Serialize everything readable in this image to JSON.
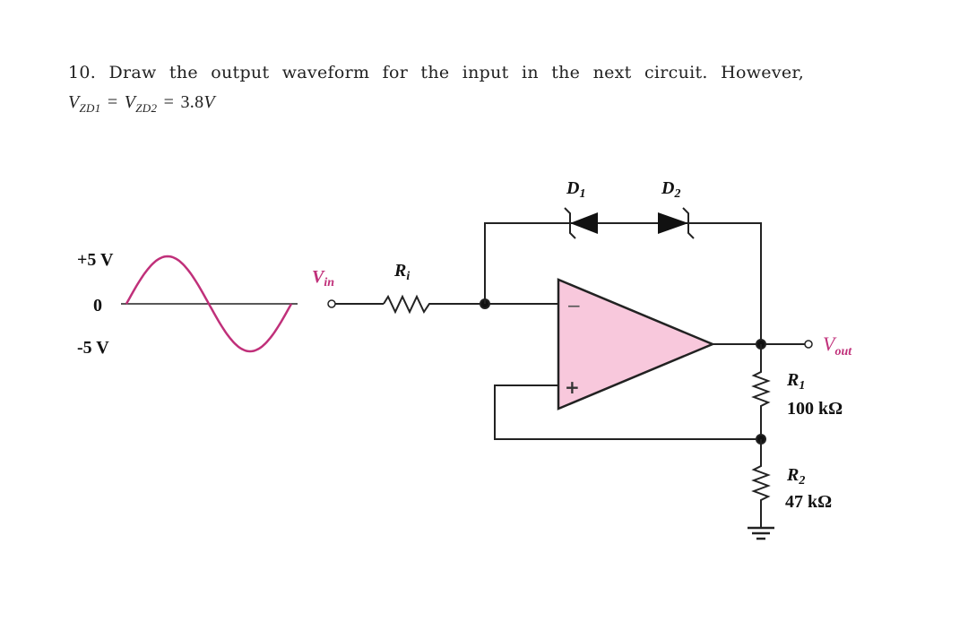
{
  "question": {
    "line1": "10. Draw the output waveform for the input in the next circuit. However,",
    "line2": {
      "v1": "V",
      "s1": "ZD1",
      "eq1": " = ",
      "v2": "V",
      "s2": "ZD2",
      "rest": " = 3.8",
      "unit": "V"
    }
  },
  "input_waveform": {
    "type": "sine",
    "labels": {
      "pos": "+5 V",
      "zero": "0",
      "neg": "-5 V"
    },
    "amplitude_v": 5,
    "color": "#c0307a"
  },
  "circuit": {
    "vin": {
      "main": "V",
      "sub": "in"
    },
    "ri": {
      "main": "R",
      "sub": "i"
    },
    "d1": {
      "main": "D",
      "sub": "1"
    },
    "d2": {
      "main": "D",
      "sub": "2"
    },
    "opamp": {
      "minus": "−",
      "plus": "+",
      "fill": "#f8c8dc"
    },
    "vout": {
      "main": "V",
      "sub": "out"
    },
    "r1": {
      "main": "R",
      "sub": "1",
      "value": "100 kΩ"
    },
    "r2": {
      "main": "R",
      "sub": "2",
      "value": "47 kΩ"
    }
  }
}
